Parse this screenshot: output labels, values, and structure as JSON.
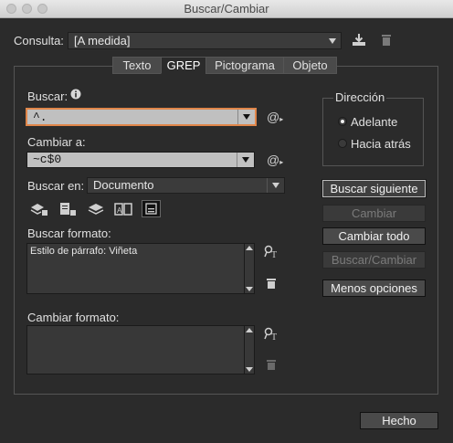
{
  "window": {
    "title": "Buscar/Cambiar"
  },
  "query": {
    "label": "Consulta:",
    "value": "[A medida]"
  },
  "tabs": [
    {
      "label": "Texto"
    },
    {
      "label": "GREP",
      "active": true
    },
    {
      "label": "Pictograma"
    },
    {
      "label": "Objeto"
    }
  ],
  "find": {
    "label": "Buscar:",
    "value": "^."
  },
  "change": {
    "label": "Cambiar a:",
    "value": "~c$0"
  },
  "search_in": {
    "label": "Buscar en:",
    "value": "Documento"
  },
  "find_format": {
    "label": "Buscar formato:",
    "value": "Estilo de párrafo: Viñeta"
  },
  "change_format": {
    "label": "Cambiar formato:",
    "value": ""
  },
  "direction": {
    "title": "Dirección",
    "options": [
      {
        "label": "Adelante",
        "selected": true
      },
      {
        "label": "Hacia atrás",
        "selected": false
      }
    ]
  },
  "buttons": {
    "find_next": "Buscar siguiente",
    "change": "Cambiar",
    "change_all": "Cambiar todo",
    "find_change": "Buscar/Cambiar",
    "fewer_options": "Menos opciones",
    "done": "Hecho"
  },
  "icons": {
    "at": "@",
    "info": "i"
  },
  "colors": {
    "focus_ring": "#e0864a",
    "field_bg": "#c0c0c0"
  }
}
